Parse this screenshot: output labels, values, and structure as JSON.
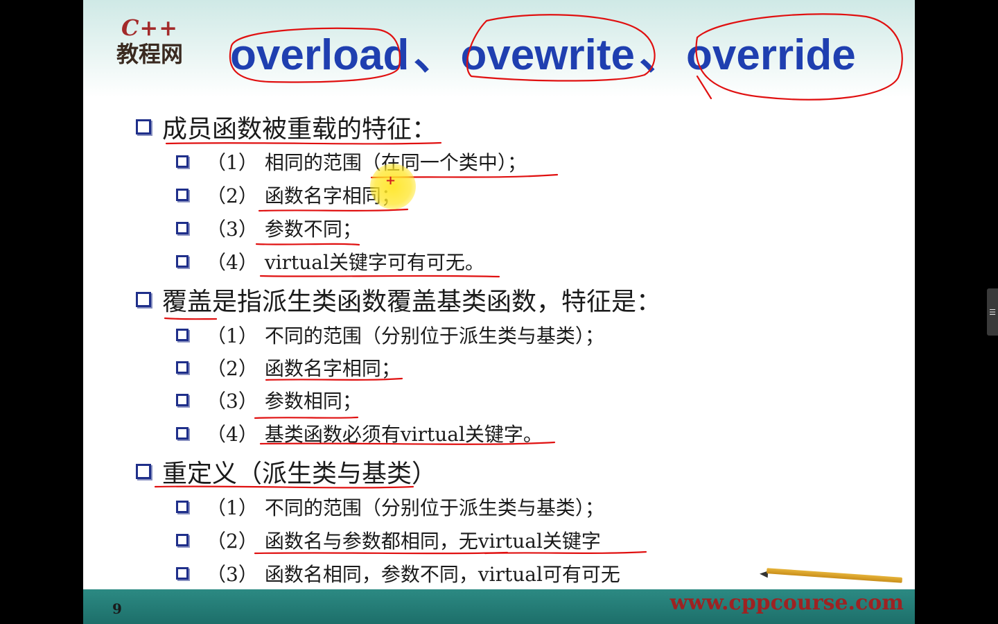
{
  "logo": {
    "line1": "C++",
    "line2": "教程网"
  },
  "title": {
    "part1": "overload",
    "sep1": "、",
    "part2": "ovewrite",
    "sep2": "、",
    "part3": "override"
  },
  "sections": [
    {
      "heading": "成员函数被重载的特征：",
      "items": [
        {
          "num": "（1）",
          "text": "相同的范围（在同一个类中）；"
        },
        {
          "num": "（2）",
          "text": "函数名字相同；"
        },
        {
          "num": "（3）",
          "text": "参数不同；"
        },
        {
          "num": "（4）",
          "text": "virtual关键字可有可无。"
        }
      ]
    },
    {
      "heading": "覆盖是指派生类函数覆盖基类函数，特征是：",
      "items": [
        {
          "num": "（1）",
          "text": "不同的范围（分别位于派生类与基类）；"
        },
        {
          "num": "（2）",
          "text": "函数名字相同；"
        },
        {
          "num": "（3）",
          "text": "参数相同；"
        },
        {
          "num": "（4）",
          "text": "基类函数必须有virtual关键字。"
        }
      ]
    },
    {
      "heading": "重定义（派生类与基类）",
      "items": [
        {
          "num": "（1）",
          "text": "不同的范围（分别位于派生类与基类）；"
        },
        {
          "num": "（2）",
          "text": "函数名与参数都相同，无virtual关键字"
        },
        {
          "num": "（3）",
          "text": "函数名相同，参数不同，virtual可有可无"
        }
      ]
    }
  ],
  "cursor": {
    "symbol": "+"
  },
  "footer": {
    "page_number": "9",
    "url": "www.cppcourse.com"
  },
  "colors": {
    "title_blue": "#1f3fb0",
    "annotation_red": "#e01010",
    "footer_teal": "#1d6f6a",
    "url_red": "#9e2222",
    "bullet_navy": "#1f2f8a"
  },
  "icons": {
    "side_widget": "list-icon"
  }
}
